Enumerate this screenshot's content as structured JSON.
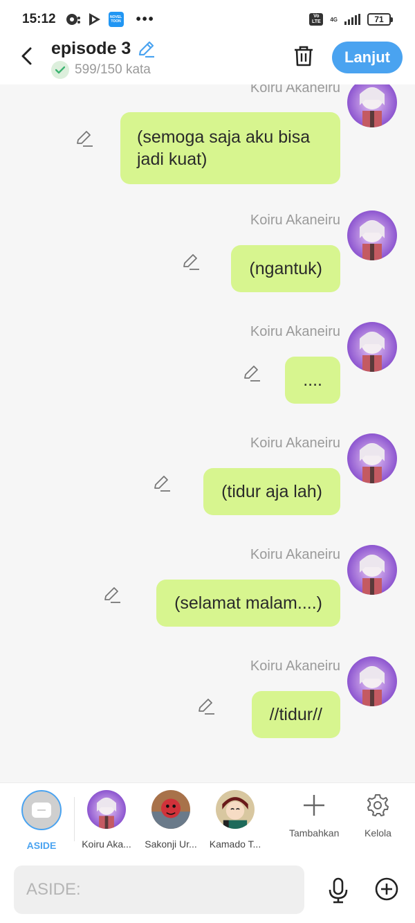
{
  "status_bar": {
    "time": "15:12",
    "network": "4G",
    "volte": "Vo LTE",
    "battery": "71",
    "app_icon_text": "NOVEL TOON"
  },
  "header": {
    "title": "episode 3",
    "word_count": "599/150 kata",
    "next_label": "Lanjut"
  },
  "messages": [
    {
      "sender": "Koiru Akaneiru",
      "text_line1": "(semoga saja aku bisa",
      "text_line2": "jadi kuat)"
    },
    {
      "sender": "Koiru Akaneiru",
      "text": "(ngantuk)"
    },
    {
      "sender": "Koiru Akaneiru",
      "text": "...."
    },
    {
      "sender": "Koiru Akaneiru",
      "text": "(tidur aja lah)"
    },
    {
      "sender": "Koiru Akaneiru",
      "text": "(selamat malam....)"
    },
    {
      "sender": "Koiru Akaneiru",
      "text": "//tidur//"
    }
  ],
  "characters": [
    {
      "name": "ASIDE"
    },
    {
      "name": "Koiru Aka..."
    },
    {
      "name": "Sakonji Ur..."
    },
    {
      "name": "Kamado T..."
    }
  ],
  "tools": {
    "add_label": "Tambahkan",
    "manage_label": "Kelola"
  },
  "input": {
    "placeholder": "ASIDE:"
  },
  "colors": {
    "accent": "#4aa3f0",
    "bubble": "#d7f58f",
    "background": "#f6f6f6"
  }
}
